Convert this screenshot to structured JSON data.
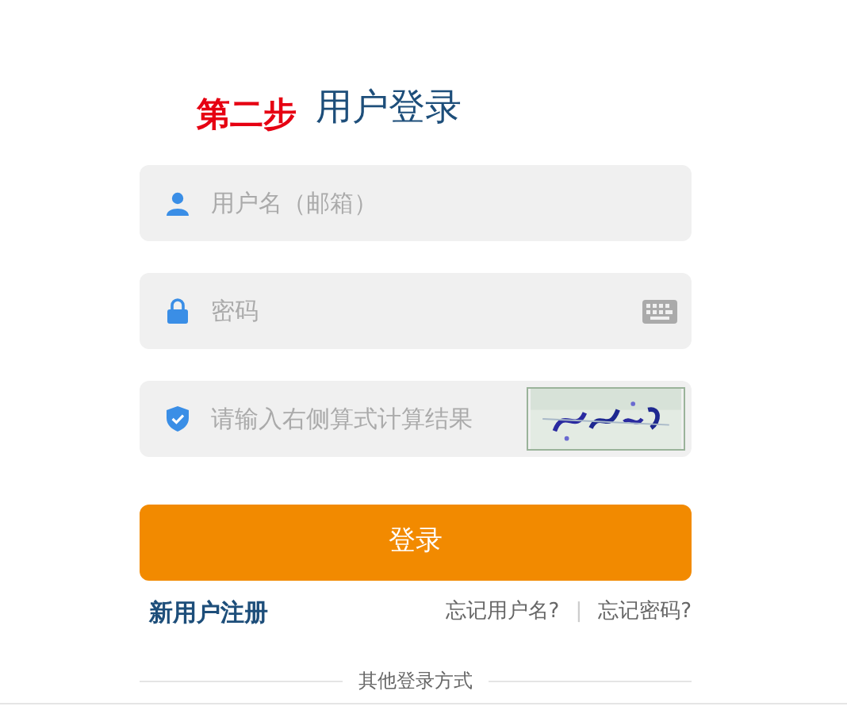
{
  "step_label": "第二步",
  "title": "用户登录",
  "fields": [
    {
      "kind": "user",
      "placeholder": "用户名（邮箱）"
    },
    {
      "kind": "password",
      "placeholder": "密码"
    },
    {
      "kind": "captcha",
      "placeholder": "请输入右侧算式计算结果"
    }
  ],
  "login_button": "登录",
  "register_link": "新用户注册",
  "forgot_links": [
    "忘记用户名?",
    "忘记密码?"
  ],
  "separator": "|",
  "other_methods": "其他登录方式"
}
